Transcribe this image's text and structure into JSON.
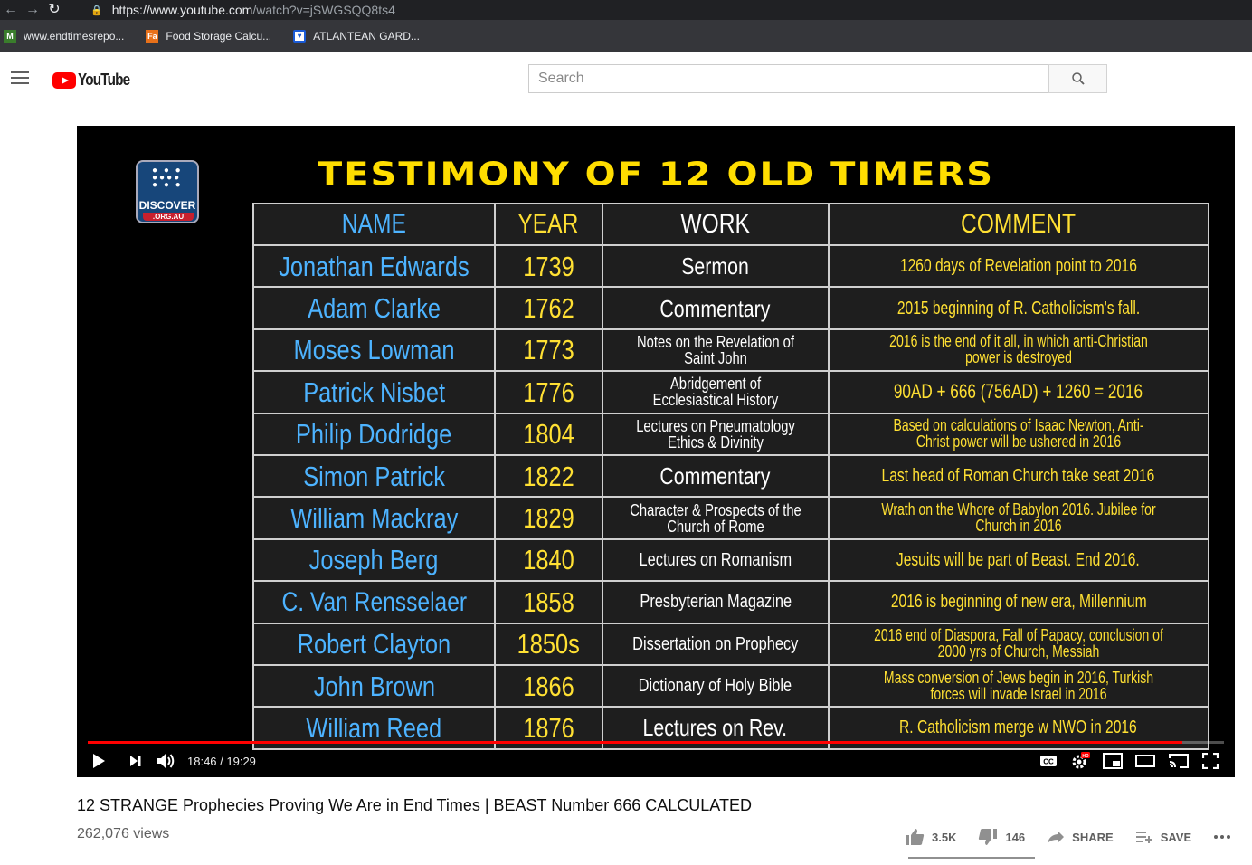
{
  "browser": {
    "url_main": "https://www.youtube.com",
    "url_path": "/watch?v=jSWGSQQ8ts4",
    "bookmarks": [
      {
        "label": "www.endtimesrepo...",
        "icon": "endtimes-favicon",
        "color": "#3a7d2c"
      },
      {
        "label": "Food Storage Calcu...",
        "icon": "fa-favicon",
        "color": "#e8711a"
      },
      {
        "label": "ATLANTEAN GARD...",
        "icon": "shield-heart-favicon",
        "color": "#1a5bd6"
      }
    ]
  },
  "youtube": {
    "logo_text": "YouTube",
    "search_placeholder": "Search"
  },
  "video": {
    "channel_logo_text": "DISCOVER",
    "channel_logo_sub": ".ORG.AU",
    "slide_title": "TESTIMONY OF 12 OLD TIMERS",
    "table": {
      "headers": [
        "NAME",
        "YEAR",
        "WORK",
        "COMMENT"
      ],
      "rows": [
        {
          "name": "Jonathan Edwards",
          "year": "1739",
          "work": "Sermon",
          "comment": "1260 days of Revelation point to 2016"
        },
        {
          "name": "Adam Clarke",
          "year": "1762",
          "work": "Commentary",
          "comment": "2015 beginning of R. Catholicism's fall."
        },
        {
          "name": "Moses Lowman",
          "year": "1773",
          "work": "Notes on the Revelation of Saint John",
          "comment": "2016 is the end of it all, in which anti-Christian power is destroyed"
        },
        {
          "name": "Patrick Nisbet",
          "year": "1776",
          "work": "Abridgement of Ecclesiastical History",
          "comment": "90AD + 666 (756AD) + 1260 = 2016"
        },
        {
          "name": "Philip Dodridge",
          "year": "1804",
          "work": "Lectures on Pneumatology Ethics & Divinity",
          "comment": "Based on calculations of Isaac Newton, Anti-Christ power will be ushered in 2016"
        },
        {
          "name": "Simon Patrick",
          "year": "1822",
          "work": "Commentary",
          "comment": "Last head of Roman Church take seat 2016"
        },
        {
          "name": "William Mackray",
          "year": "1829",
          "work": "Character & Prospects of the Church of Rome",
          "comment": "Wrath on the Whore of Babylon 2016. Jubilee for Church in 2016"
        },
        {
          "name": "Joseph Berg",
          "year": "1840",
          "work": "Lectures on Romanism",
          "comment": "Jesuits will be part of Beast. End 2016."
        },
        {
          "name": "C. Van Rensselaer",
          "year": "1858",
          "work": "Presbyterian Magazine",
          "comment": "2016 is beginning of new era, Millennium"
        },
        {
          "name": "Robert Clayton",
          "year": "1850s",
          "work": "Dissertation on Prophecy",
          "comment": "2016 end of Diaspora, Fall of Papacy, conclusion of 2000 yrs of Church, Messiah"
        },
        {
          "name": "John Brown",
          "year": "1866",
          "work": "Dictionary of Holy Bible",
          "comment": "Mass conversion of Jews begin in 2016, Turkish forces will invade Israel in 2016"
        },
        {
          "name": "William Reed",
          "year": "1876",
          "work": "Lectures on Rev.",
          "comment": "R. Catholicism merge w NWO in 2016"
        }
      ]
    },
    "player": {
      "time": "18:46 / 19:29",
      "progress": 0.963
    }
  },
  "info": {
    "title": "12 STRANGE Prophecies Proving We Are in End Times | BEAST Number 666 CALCULATED",
    "views": "262,076 views",
    "likes": "3.5K",
    "dislikes": "146",
    "share_label": "SHARE",
    "save_label": "SAVE"
  }
}
